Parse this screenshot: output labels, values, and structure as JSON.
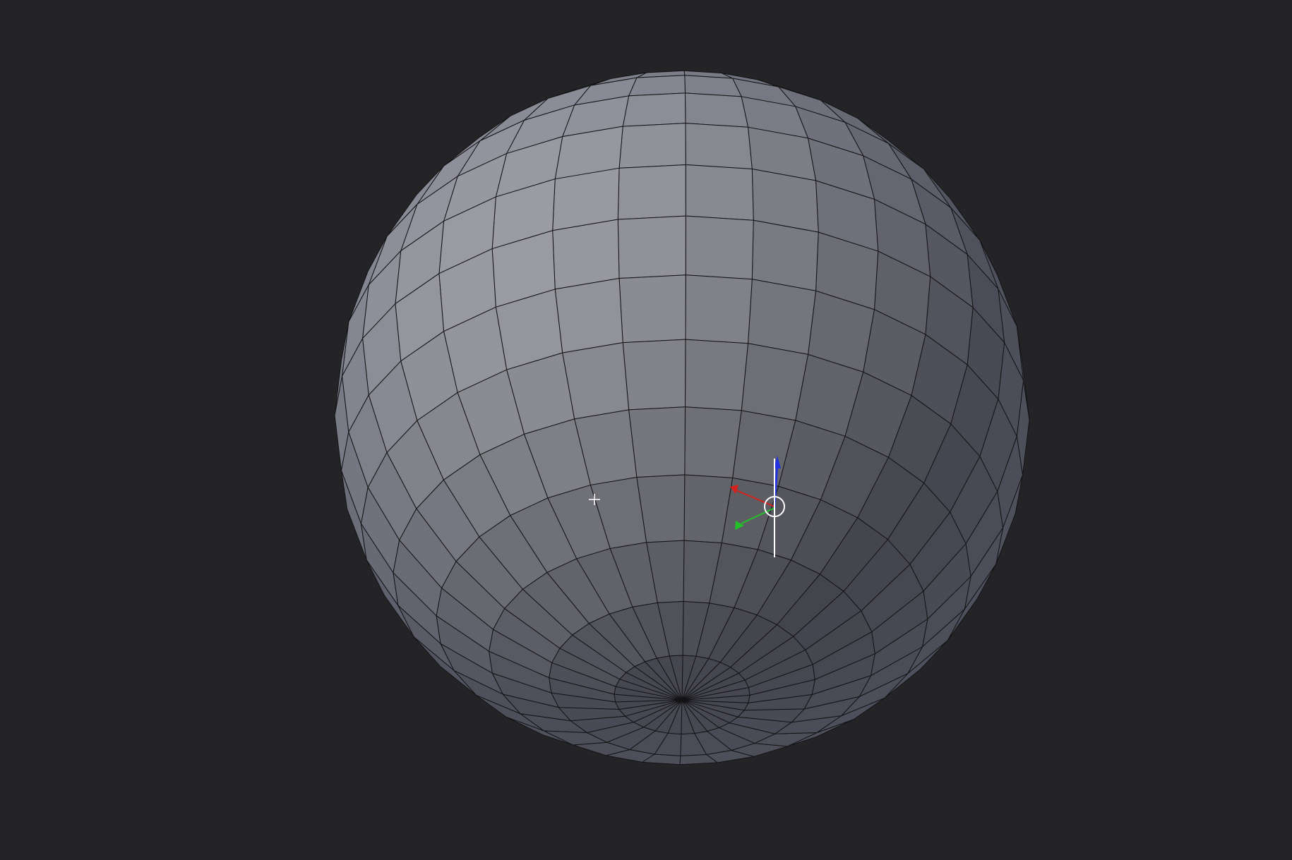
{
  "viewport": {
    "background": "#242426",
    "mesh": {
      "object": "uv-sphere",
      "segments": 32,
      "rings": 16,
      "deleted_faces": "window-opening",
      "shade_light": "#a2a3a7",
      "shade_mid": "#76777d",
      "shade_dark": "#3f4046",
      "edge_color": "#141416",
      "inner_shade": "#5b5e6e"
    },
    "gizmo": {
      "type": "transform-manipulator",
      "x_axis_color": "#d8201c",
      "y_axis_color": "#22c02a",
      "z_axis_color": "#2233dd",
      "pivot_color": "#ffffff"
    },
    "cursor": {
      "type": "3d-cursor-crosshair",
      "color": "#ffffff"
    }
  }
}
